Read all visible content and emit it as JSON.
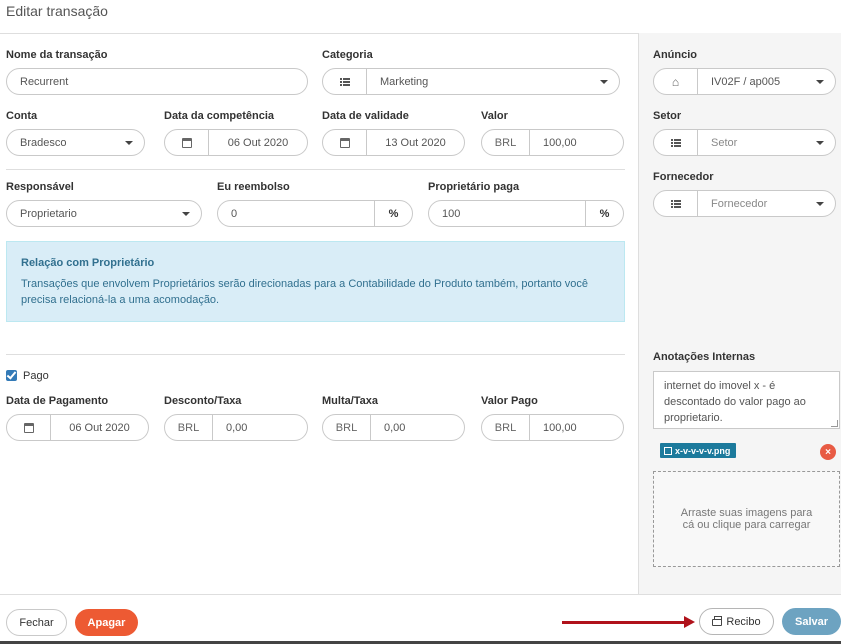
{
  "title": "Editar transação",
  "fields": {
    "nome": {
      "label": "Nome da transação",
      "value": "Recurrent"
    },
    "categoria": {
      "label": "Categoria",
      "value": "Marketing"
    },
    "conta": {
      "label": "Conta",
      "value": "Bradesco"
    },
    "competencia": {
      "label": "Data da competência",
      "value": "06 Out 2020"
    },
    "validade": {
      "label": "Data de validade",
      "value": "13 Out 2020"
    },
    "valor": {
      "label": "Valor",
      "currency": "BRL",
      "value": "100,00"
    },
    "responsavel": {
      "label": "Responsável",
      "value": "Proprietario"
    },
    "reembolso": {
      "label": "Eu reembolso",
      "value": "0",
      "unit": "%"
    },
    "proprietario_paga": {
      "label": "Proprietário paga",
      "value": "100",
      "unit": "%"
    }
  },
  "info_box": {
    "heading": "Relação com Proprietário",
    "text": "Transações que envolvem Proprietários serão direcionadas para a Contabilidade do Produto também, portanto você precisa relacioná-la a uma acomodação."
  },
  "pago": {
    "label": "Pago",
    "checked": true
  },
  "payment": {
    "data": {
      "label": "Data de Pagamento",
      "value": "06 Out 2020"
    },
    "desconto": {
      "label": "Desconto/Taxa",
      "currency": "BRL",
      "value": "0,00"
    },
    "multa": {
      "label": "Multa/Taxa",
      "currency": "BRL",
      "value": "0,00"
    },
    "valor_pago": {
      "label": "Valor Pago",
      "currency": "BRL",
      "value": "100,00"
    }
  },
  "sidebar": {
    "anuncio": {
      "label": "Anúncio",
      "value": "IV02F / ap005"
    },
    "setor": {
      "label": "Setor",
      "placeholder": "Setor"
    },
    "fornecedor": {
      "label": "Fornecedor",
      "placeholder": "Fornecedor"
    },
    "anotacoes": {
      "label": "Anotações Internas",
      "value": "internet do imovel x - é descontado do valor pago ao proprietario."
    },
    "file": {
      "name": "x-v-v-v-v.png",
      "remove": "×"
    },
    "dropzone": "Arraste suas imagens para cá ou clique para carregar"
  },
  "buttons": {
    "fechar": "Fechar",
    "apagar": "Apagar",
    "recibo": "Recibo",
    "salvar": "Salvar"
  },
  "colors": {
    "danger": "#ed5a33",
    "primary": "#6da3c1",
    "info_bg": "#d9edf7",
    "info_text": "#31708f",
    "file_tag": "#1c7a9c",
    "arrow": "#b0121b"
  }
}
